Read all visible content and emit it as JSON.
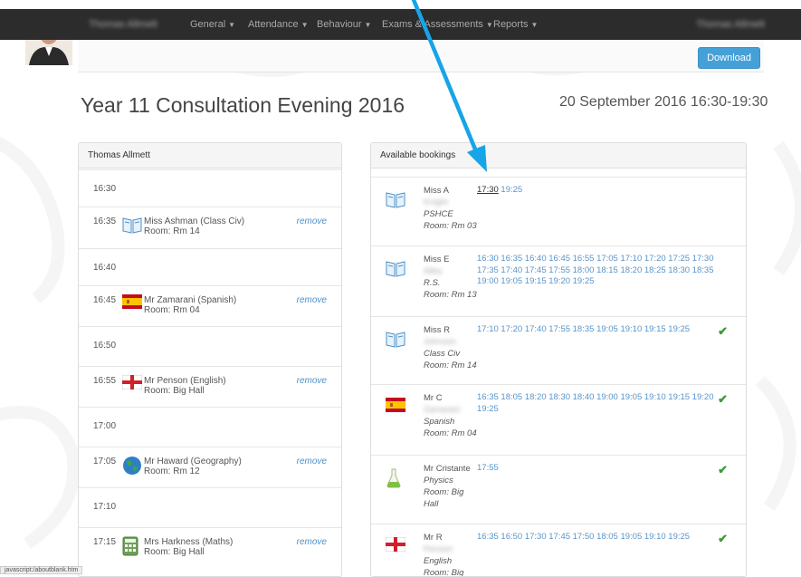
{
  "nav": {
    "user": "Thomas Allmett",
    "items": [
      {
        "label": "General"
      },
      {
        "label": "Attendance"
      },
      {
        "label": "Behaviour"
      },
      {
        "label": "Exams & Assessments"
      },
      {
        "label": "Reports"
      }
    ],
    "right_user": "Thomas Allmett"
  },
  "toolbar": {
    "download_label": "Download"
  },
  "page": {
    "title": "Year 11 Consultation Evening 2016",
    "date_range": "20 September 2016 16:30-19:30"
  },
  "left_panel": {
    "header": "Thomas Allmett",
    "slots": [
      {
        "time": "16:30",
        "teacher": "",
        "room": "",
        "remove": "",
        "icon": ""
      },
      {
        "time": "16:35",
        "teacher": "Miss Ashman (Class Civ)",
        "room": "Room: Rm 14",
        "remove": "remove",
        "icon": "book-icon"
      },
      {
        "time": "16:40",
        "teacher": "",
        "room": "",
        "remove": "",
        "icon": ""
      },
      {
        "time": "16:45",
        "teacher": "Mr Zamarani (Spanish)",
        "room": "Room: Rm 04",
        "remove": "remove",
        "icon": "spain-flag-icon"
      },
      {
        "time": "16:50",
        "teacher": "",
        "room": "",
        "remove": "",
        "icon": ""
      },
      {
        "time": "16:55",
        "teacher": "Mr Penson (English)",
        "room": "Room: Big Hall",
        "remove": "remove",
        "icon": "england-flag-icon"
      },
      {
        "time": "17:00",
        "teacher": "",
        "room": "",
        "remove": "",
        "icon": ""
      },
      {
        "time": "17:05",
        "teacher": "Mr Haward (Geography)",
        "room": "Room: Rm 12",
        "remove": "remove",
        "icon": "globe-icon"
      },
      {
        "time": "17:10",
        "teacher": "",
        "room": "",
        "remove": "",
        "icon": ""
      },
      {
        "time": "17:15",
        "teacher": "Mrs Harkness (Maths)",
        "room": "Room: Big Hall",
        "remove": "remove",
        "icon": "calculator-icon"
      }
    ]
  },
  "right_panel": {
    "header": "Available bookings",
    "rows": [
      {
        "teacher_line1": "Miss A",
        "teacher_line2": "Knight",
        "subject": "PSHCE",
        "room": "Room: Rm 03",
        "times_first": "17:30",
        "times_rest": " 19:25",
        "check": "",
        "icon": "book-icon"
      },
      {
        "teacher_line1": "Miss E",
        "teacher_line2": "Alley",
        "subject": "R.S.",
        "room": "Room: Rm 13",
        "times_first": "",
        "times_rest": "16:30 16:35 16:40 16:45 16:55 17:05 17:10 17:20 17:25 17:30 17:35 17:40 17:45 17:55 18:00 18:15 18:20 18:25 18:30 18:35 19:00 19:05 19:15 19:20 19:25",
        "check": "",
        "icon": "book-icon"
      },
      {
        "teacher_line1": "Miss R",
        "teacher_line2": "Johnson",
        "subject": "Class Civ",
        "room": "Room: Rm 14",
        "times_first": "",
        "times_rest": "17:10 17:20 17:40 17:55 18:35 19:05 19:10 19:15 19:25",
        "check": "✔",
        "icon": "book-icon"
      },
      {
        "teacher_line1": "Mr C",
        "teacher_line2": "Zamarani",
        "subject": "Spanish",
        "room": "Room: Rm 04",
        "times_first": "",
        "times_rest": "16:35 18:05 18:20 18:30 18:40 19:00 19:05 19:10 19:15 19:20 19:25",
        "check": "✔",
        "icon": "spain-flag-icon"
      },
      {
        "teacher_line1": "Mr Cristante",
        "teacher_line2": "",
        "subject": "Physics",
        "room": "Room: Big Hall",
        "times_first": "",
        "times_rest": "17:55",
        "check": "✔",
        "icon": "flask-icon"
      },
      {
        "teacher_line1": "Mr R",
        "teacher_line2": "Penson",
        "subject": "English",
        "room": "Room: Big Hall",
        "times_first": "",
        "times_rest": "16:35 16:50 17:30 17:45 17:50 18:05 19:05 19:10 19:25",
        "check": "✔",
        "icon": "england-flag-icon"
      }
    ]
  },
  "status_bar": {
    "url": "javascript:/aboutblank.htm"
  },
  "colors": {
    "accent": "#46a0d8",
    "link": "#5a94c9",
    "check": "#3a9b3a",
    "navbar": "#2c2c2c"
  }
}
